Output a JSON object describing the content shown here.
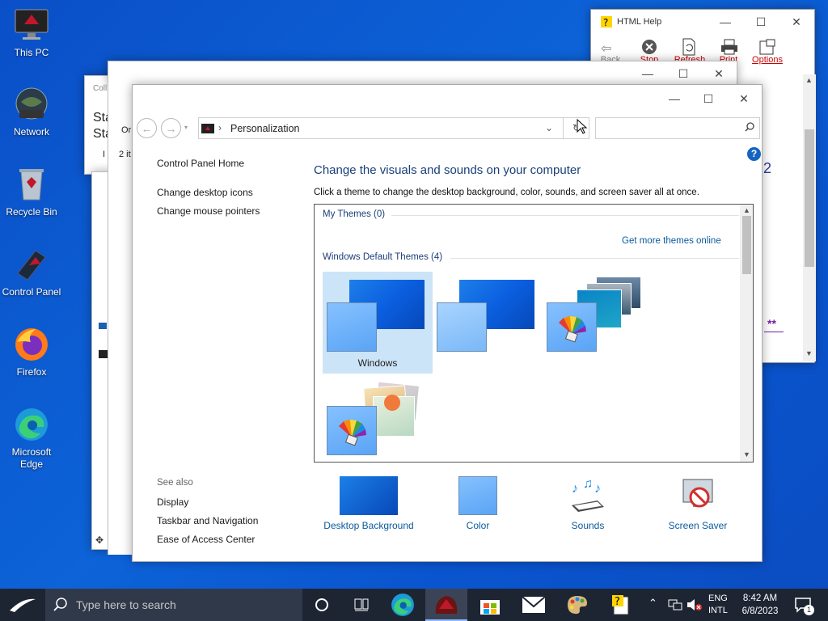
{
  "desktop": {
    "icons": [
      {
        "label": "This PC"
      },
      {
        "label": "Network"
      },
      {
        "label": "Recycle Bin"
      },
      {
        "label": "Control Panel"
      },
      {
        "label": "Firefox"
      },
      {
        "label": "Microsoft Edge"
      }
    ]
  },
  "help_window": {
    "title": "HTML Help",
    "toolbar": [
      "Back",
      "Stop",
      "Refresh",
      "Print",
      "Options"
    ],
    "link_fragment": "**"
  },
  "bg_window": {
    "title_fragment": "Coll",
    "heading_fragment": "Sta",
    "heading_fragment2": "Sta",
    "row1": "Or",
    "row2": "I",
    "count": "2 it"
  },
  "personalization": {
    "breadcrumb": "Personalization",
    "search_placeholder": "",
    "left_links": [
      "Control Panel Home",
      "Change desktop icons",
      "Change mouse pointers"
    ],
    "see_also_heading": "See also",
    "see_also_links": [
      "Display",
      "Taskbar and Navigation",
      "Ease of Access Center"
    ],
    "heading": "Change the visuals and sounds on your computer",
    "description": "Click a theme to change the desktop background, color, sounds, and screen saver all at once.",
    "my_themes": "My Themes (0)",
    "get_more": "Get more themes online",
    "default_themes": "Windows Default Themes (4)",
    "themes": [
      {
        "label": "Windows",
        "selected": true
      },
      {
        "label": ""
      },
      {
        "label": ""
      },
      {
        "label": ""
      }
    ],
    "bottom": [
      {
        "label": "Desktop Background"
      },
      {
        "label": "Color"
      },
      {
        "label": "Sounds"
      },
      {
        "label": "Screen Saver"
      }
    ],
    "help_glyph": "?"
  },
  "taskbar": {
    "search_placeholder": "Type here to search",
    "lang1": "ENG",
    "lang2": "INTL",
    "time": "8:42 AM",
    "date": "6/8/2023",
    "notif_count": "1"
  }
}
